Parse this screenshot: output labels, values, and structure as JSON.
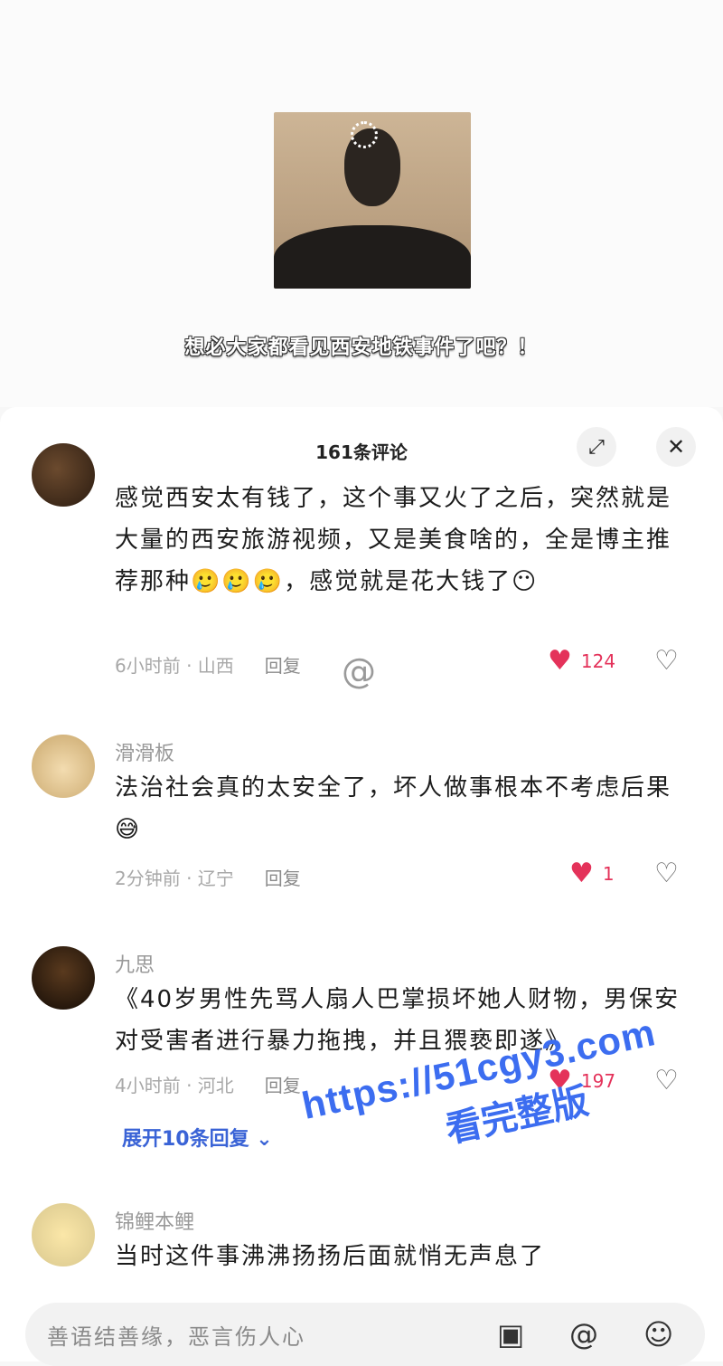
{
  "video": {
    "subtitle": "想必大家都看见西安地铁事件了吧？！"
  },
  "sheet": {
    "title": "161条评论",
    "expand_icon": "expand-icon",
    "close_icon": "close-icon"
  },
  "comments": [
    {
      "nick": "",
      "text": "感觉西安太有钱了，这个事又火了之后，突然就是大量的西安旅游视频，又是美食啥的，全是博主推荐那种🥲🥲🥲，感觉就是花大钱了😶",
      "time_loc": "6小时前 · 山西",
      "reply": "回复",
      "likes": "124"
    },
    {
      "nick": "滑滑板",
      "text": "法治社会真的太安全了，坏人做事根本不考虑后果😅",
      "time_loc": "2分钟前 · 辽宁",
      "reply": "回复",
      "likes": "1"
    },
    {
      "nick": "九思",
      "text": "《40岁男性先骂人扇人巴掌损坏她人财物，男保安对受害者进行暴力拖拽，并且猥亵即遂》",
      "time_loc": "4小时前 · 河北",
      "reply": "回复",
      "likes": "197",
      "expand_replies": "展开10条回复"
    },
    {
      "nick": "锦鲤本鲤",
      "text": "当时这件事沸沸扬扬后面就悄无声息了"
    }
  ],
  "watermark": {
    "line1": "https://51cgy3.com",
    "line2": "看完整版"
  },
  "input": {
    "placeholder": "善语结善缘，恶言伤人心"
  },
  "colors": {
    "like": "#e4325a",
    "link": "#3a63d6",
    "watermark": "#3c6df0"
  }
}
